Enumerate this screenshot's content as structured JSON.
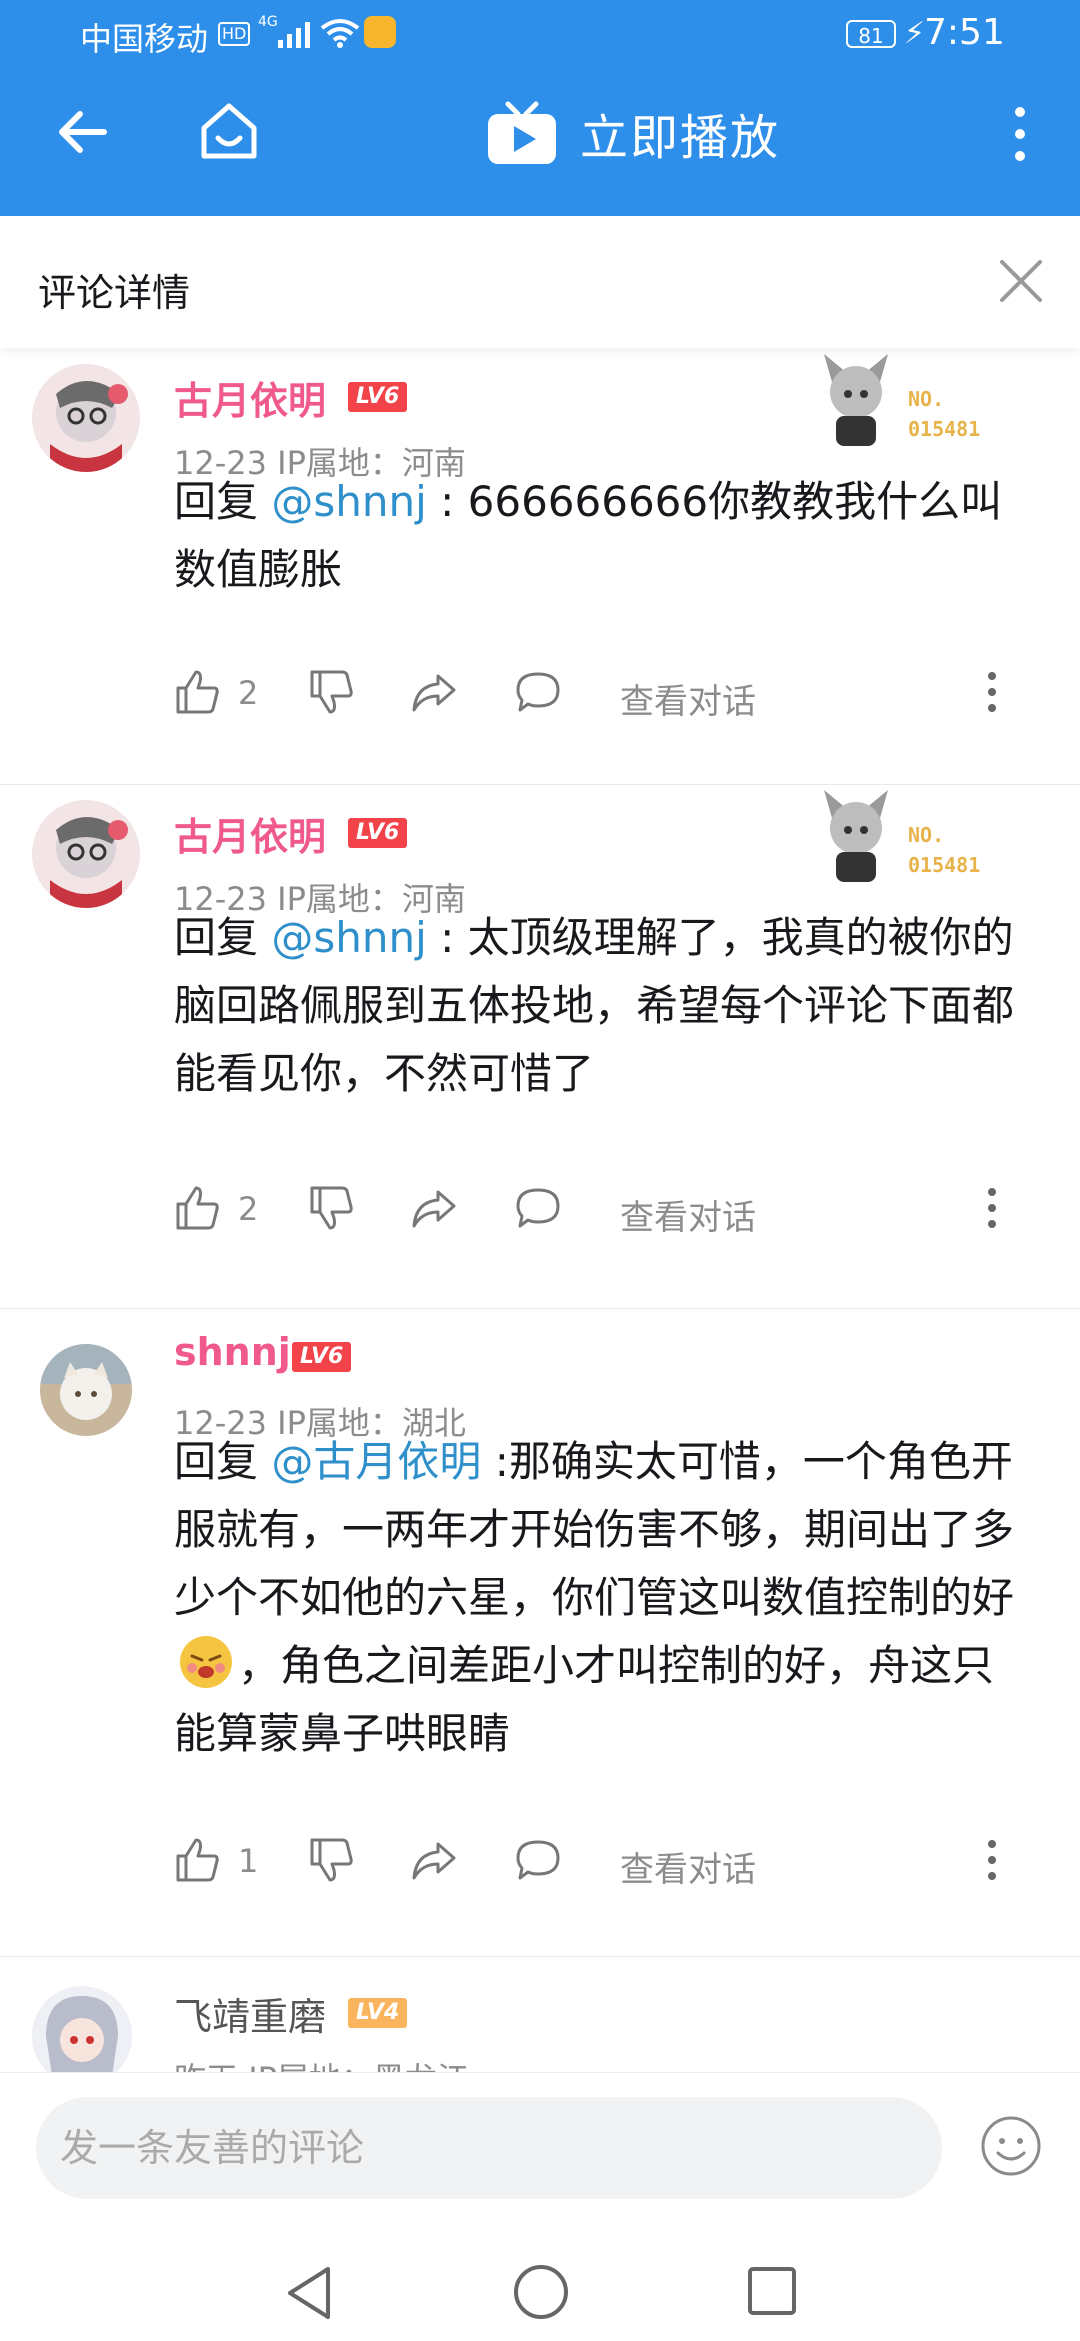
{
  "status_bar": {
    "carrier": "中国移动",
    "hd": "HD",
    "network": "4G",
    "battery": "81",
    "time": "7:51"
  },
  "app_bar": {
    "play_label": "立即播放"
  },
  "panel": {
    "title": "评论详情"
  },
  "comments": [
    {
      "username": "古月依明",
      "level": "LV6",
      "date": "12-23",
      "ip_prefix": "IP属地：",
      "ip_location": "河南",
      "reply_prefix": "回复 ",
      "mention": "@shnnj",
      "text": " : 666666666你教教我什么叫数值膨胀",
      "likes": "2",
      "view_dialog": "查看对话",
      "badge_no": "NO.",
      "badge_num": "015481"
    },
    {
      "username": "古月依明",
      "level": "LV6",
      "date": "12-23",
      "ip_prefix": "IP属地：",
      "ip_location": "河南",
      "reply_prefix": "回复 ",
      "mention": "@shnnj",
      "text": " : 太顶级理解了，我真的被你的脑回路佩服到五体投地，希望每个评论下面都能看见你，不然可惜了",
      "likes": "2",
      "view_dialog": "查看对话",
      "badge_no": "NO.",
      "badge_num": "015481"
    },
    {
      "username": "shnnj",
      "level": "LV6",
      "date": "12-23",
      "ip_prefix": "IP属地：",
      "ip_location": "湖北",
      "reply_prefix": "回复 ",
      "mention": "@古月依明",
      "text": " :那确实太可惜，一个角色开服就有，一两年才开始伤害不够，期间出了多少个不如他的六星，你们管这叫数值控制的好",
      "text2": "，角色之间差距小才叫控制的好，舟这只能算蒙鼻子哄眼睛",
      "likes": "1",
      "view_dialog": "查看对话"
    },
    {
      "username": "飞靖重磨",
      "level": "LV4",
      "date": "昨天",
      "ip_prefix": "IP属地：",
      "ip_location": "黑龙江"
    }
  ],
  "input": {
    "placeholder": "发一条友善的评论"
  },
  "colors": {
    "app_bar": "#2e8fea",
    "username_vip": "#f05a8a",
    "mention": "#2e8fca",
    "level_badge": "#f3434a"
  }
}
